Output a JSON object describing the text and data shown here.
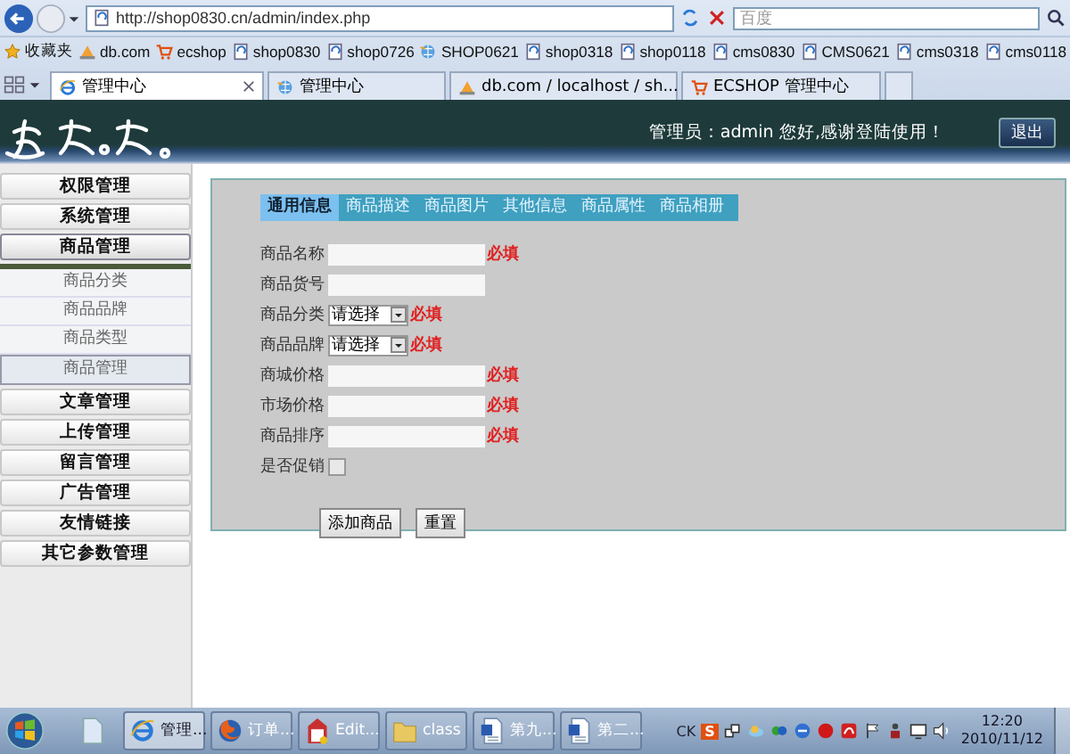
{
  "browser": {
    "address": "http://shop0830.cn/admin/index.php",
    "search_placeholder": "百度",
    "favorites": [
      {
        "label": "收藏夹",
        "kind": "star"
      },
      {
        "label": "db.com",
        "kind": "pma"
      },
      {
        "label": "ecshop",
        "kind": "cart"
      },
      {
        "label": "shop0830",
        "kind": "page"
      },
      {
        "label": "shop0726",
        "kind": "page"
      },
      {
        "label": "SHOP0621",
        "kind": "globe"
      },
      {
        "label": "shop0318",
        "kind": "page"
      },
      {
        "label": "shop0118",
        "kind": "page"
      },
      {
        "label": "cms0830",
        "kind": "page"
      },
      {
        "label": "CMS0621",
        "kind": "page"
      },
      {
        "label": "cms0318",
        "kind": "page"
      },
      {
        "label": "cms0118",
        "kind": "page"
      }
    ],
    "tabs": [
      {
        "label": "管理中心",
        "kind": "ie",
        "selected": true
      },
      {
        "label": "管理中心",
        "kind": "globe",
        "selected": false
      },
      {
        "label": "db.com / localhost / sh...",
        "kind": "pma",
        "selected": false
      },
      {
        "label": "ECSHOP 管理中心",
        "kind": "cart",
        "selected": false
      }
    ]
  },
  "header": {
    "greeting": "管理员：admin 您好,感谢登陆使用！",
    "logout": "退出"
  },
  "sidebar": [
    {
      "label": "权限管理",
      "expanded": false
    },
    {
      "label": "系统管理",
      "expanded": false
    },
    {
      "label": "商品管理",
      "expanded": true,
      "children": [
        {
          "label": "商品分类",
          "selected": false
        },
        {
          "label": "商品品牌",
          "selected": false
        },
        {
          "label": "商品类型",
          "selected": false
        },
        {
          "label": "商品管理",
          "selected": true
        }
      ]
    },
    {
      "label": "文章管理",
      "expanded": false
    },
    {
      "label": "上传管理",
      "expanded": false
    },
    {
      "label": "留言管理",
      "expanded": false
    },
    {
      "label": "广告管理",
      "expanded": false
    },
    {
      "label": "友情链接",
      "expanded": false
    },
    {
      "label": "其它参数管理",
      "expanded": false
    }
  ],
  "form": {
    "tabs": [
      {
        "label": "通用信息",
        "selected": true
      },
      {
        "label": "商品描述",
        "selected": false
      },
      {
        "label": "商品图片",
        "selected": false
      },
      {
        "label": "其他信息",
        "selected": false
      },
      {
        "label": "商品属性",
        "selected": false
      },
      {
        "label": "商品相册",
        "selected": false
      }
    ],
    "fields": [
      {
        "label": "商品名称",
        "kind": "text",
        "required": "必填"
      },
      {
        "label": "商品货号",
        "kind": "text"
      },
      {
        "label": "商品分类",
        "kind": "select",
        "value": "请选择",
        "required": "必填"
      },
      {
        "label": "商品品牌",
        "kind": "select",
        "value": "请选择",
        "required": "必填"
      },
      {
        "label": "商城价格",
        "kind": "text",
        "required": "必填"
      },
      {
        "label": "市场价格",
        "kind": "text",
        "required": "必填"
      },
      {
        "label": "商品排序",
        "kind": "text",
        "required": "必填"
      },
      {
        "label": "是否促销",
        "kind": "checkbox",
        "checked": false
      }
    ],
    "buttons": [
      "添加商品",
      "重置"
    ]
  },
  "taskbar": {
    "items": [
      {
        "kind": "file",
        "selected": false
      },
      {
        "label": "管理...",
        "kind": "ie",
        "selected": true
      },
      {
        "label": "订单...",
        "kind": "firefox",
        "selected": false
      },
      {
        "label": "Edit...",
        "kind": "editor",
        "selected": false
      },
      {
        "label": "class",
        "kind": "folder",
        "selected": false
      },
      {
        "label": "第九...",
        "kind": "word",
        "selected": false
      },
      {
        "label": "第二...",
        "kind": "word",
        "selected": false
      }
    ],
    "tray_text": "CK",
    "tray_badge": "S",
    "time": "12:20",
    "date": "2010/11/12"
  }
}
